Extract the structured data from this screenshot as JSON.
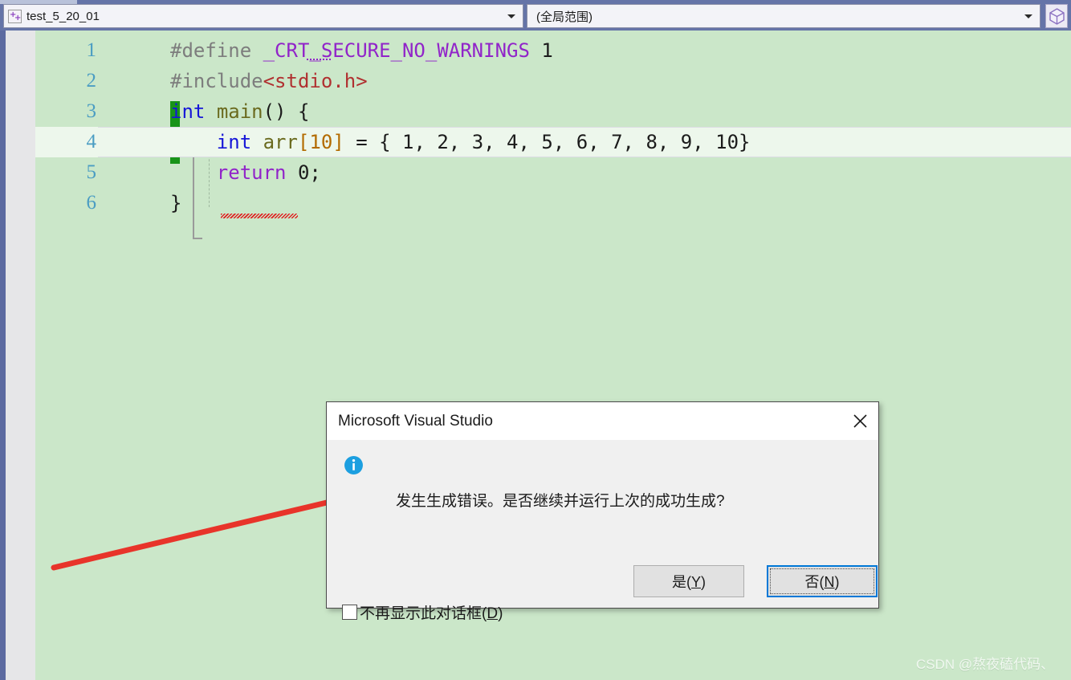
{
  "topbar": {
    "file_combo": {
      "icon": "cpp-file-icon",
      "value": "test_5_20_01",
      "dropdown_icon": "chevron-down-icon"
    },
    "scope_combo": {
      "value": "(全局范围)",
      "dropdown_icon": "chevron-down-icon"
    },
    "cube_button_icon": "cube-icon"
  },
  "editor": {
    "lines": [
      {
        "number": "1",
        "segments": [
          {
            "text": "#define ",
            "style": "k-pre"
          },
          {
            "text": "_CRT_SECURE_NO_WARNINGS",
            "style": "k-macro"
          },
          {
            "text": " 1",
            "style": "k-num"
          }
        ]
      },
      {
        "number": "2",
        "segments": [
          {
            "text": "#include",
            "style": "k-pre"
          },
          {
            "text": "<stdio.h>",
            "style": "k-str"
          }
        ]
      },
      {
        "number": "3",
        "segments": [
          {
            "text": "int",
            "style": "k-kw"
          },
          {
            "text": " ",
            "style": "k-punct"
          },
          {
            "text": "main",
            "style": "k-id"
          },
          {
            "text": "() {",
            "style": "k-punct"
          }
        ]
      },
      {
        "number": "4",
        "segments": [
          {
            "text": "    ",
            "style": "k-punct"
          },
          {
            "text": "int",
            "style": "k-kw"
          },
          {
            "text": " ",
            "style": "k-punct"
          },
          {
            "text": "arr",
            "style": "k-id"
          },
          {
            "text": "[10]",
            "style": "k-br"
          },
          {
            "text": " = { 1, 2, 3, 4, 5, 6, 7, 8, 9, 10}",
            "style": "k-punct"
          }
        ]
      },
      {
        "number": "5",
        "segments": [
          {
            "text": "    ",
            "style": "k-punct"
          },
          {
            "text": "return",
            "style": "k-kw2"
          },
          {
            "text": " 0;",
            "style": "k-punct"
          }
        ]
      },
      {
        "number": "6",
        "segments": [
          {
            "text": "}",
            "style": "k-punct"
          }
        ]
      }
    ],
    "current_line": "4",
    "change_bar_color": "#189418",
    "background_color": "#cbe7c9",
    "fold_icon": "collapse-minus-icon"
  },
  "annotation": {
    "arrow_color": "#e8342a",
    "from": "66,706",
    "to": "503,602"
  },
  "dialog": {
    "title": "Microsoft Visual Studio",
    "close_icon": "close-icon",
    "info_icon": "info-icon",
    "message": "发生生成错误。是否继续并运行上次的成功生成?",
    "buttons": [
      {
        "id": "yes",
        "label_prefix": "是(",
        "label_key": "Y",
        "label_suffix": ")",
        "focused": false
      },
      {
        "id": "no",
        "label_prefix": "否(",
        "label_key": "N",
        "label_suffix": ")",
        "focused": true
      }
    ],
    "checkbox": {
      "checked": false,
      "label_prefix": "不再显示此对话框(",
      "label_key": "D",
      "label_suffix": ")"
    },
    "focus_color": "#0078d7"
  },
  "watermark": {
    "text": "CSDN @熬夜磕代码、"
  }
}
